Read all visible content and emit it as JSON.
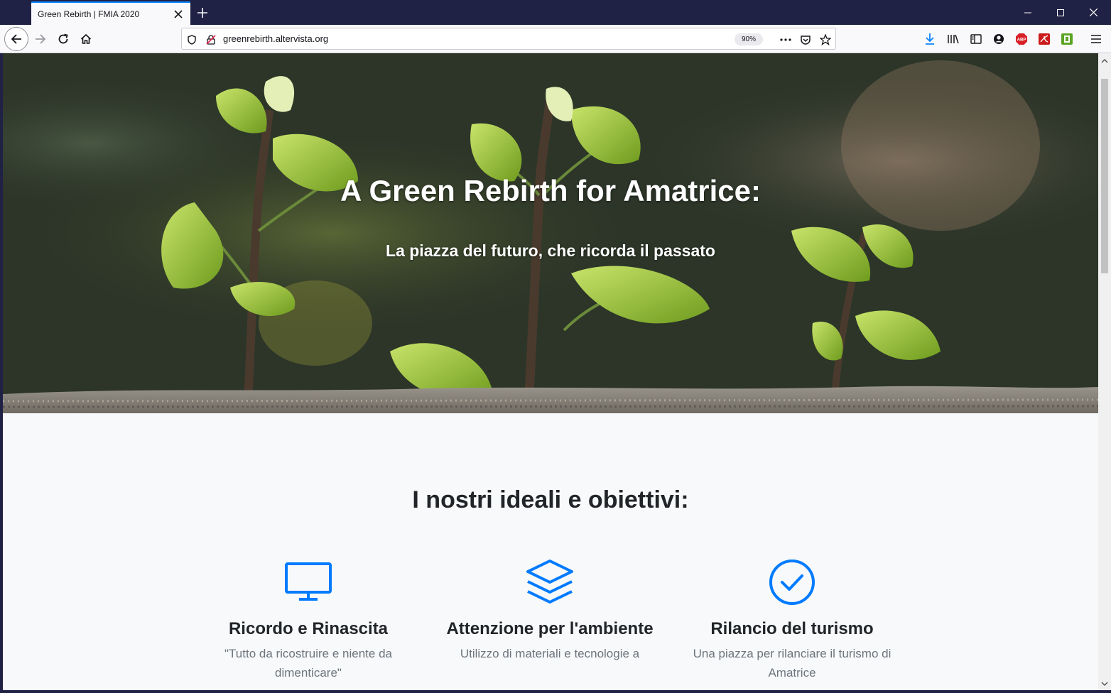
{
  "browser": {
    "tab_title": "Green Rebirth | FMIA 2020",
    "url": "greenrebirth.altervista.org",
    "zoom": "90%",
    "abp_label": "ABP"
  },
  "hero": {
    "title": "A Green Rebirth for Amatrice:",
    "subtitle": "La piazza del futuro, che ricorda il passato"
  },
  "section": {
    "title": "I nostri ideali e obiettivi:"
  },
  "features": [
    {
      "icon": "monitor-icon",
      "title": "Ricordo e Rinascita",
      "text": "\"Tutto da ricostruire e niente da dimenticare\""
    },
    {
      "icon": "layers-icon",
      "title": "Attenzione per l'ambiente",
      "text": "Utilizzo di materiali e tecnologie a"
    },
    {
      "icon": "check-circle-icon",
      "title": "Rilancio del turismo",
      "text": "Una piazza per rilanciare il turismo di Amatrice"
    }
  ],
  "colors": {
    "accent": "#007bff",
    "chrome": "#1f2145"
  }
}
